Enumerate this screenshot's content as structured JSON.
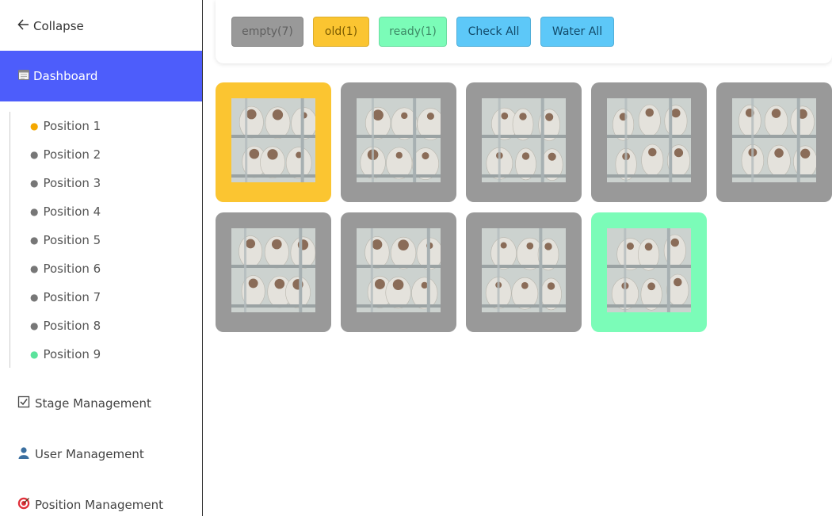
{
  "sidebar": {
    "collapse_label": "Collapse",
    "dashboard_label": "Dashboard",
    "positions": [
      {
        "label": "Position 1",
        "status": "old"
      },
      {
        "label": "Position 2",
        "status": "empty"
      },
      {
        "label": "Position 3",
        "status": "empty"
      },
      {
        "label": "Position 4",
        "status": "empty"
      },
      {
        "label": "Position 5",
        "status": "empty"
      },
      {
        "label": "Position 6",
        "status": "empty"
      },
      {
        "label": "Position 7",
        "status": "empty"
      },
      {
        "label": "Position 8",
        "status": "empty"
      },
      {
        "label": "Position 9",
        "status": "ready"
      }
    ],
    "stage_management_label": "Stage Management",
    "user_management_label": "User Management",
    "position_management_label": "Position Management"
  },
  "toolbar": {
    "empty_label": "empty(7)",
    "old_label": "old(1)",
    "ready_label": "ready(1)",
    "check_all_label": "Check All",
    "water_all_label": "Water All"
  },
  "colors": {
    "empty": "#999999",
    "old": "#fbc531",
    "ready": "#7bfcb8",
    "action": "#5dc8f8",
    "accent": "#4d5dfb"
  },
  "cards": [
    {
      "position": "Position 1",
      "status": "old"
    },
    {
      "position": "Position 2",
      "status": "empty"
    },
    {
      "position": "Position 3",
      "status": "empty"
    },
    {
      "position": "Position 4",
      "status": "empty"
    },
    {
      "position": "Position 5",
      "status": "empty"
    },
    {
      "position": "Position 6",
      "status": "empty"
    },
    {
      "position": "Position 7",
      "status": "empty"
    },
    {
      "position": "Position 8",
      "status": "empty"
    },
    {
      "position": "Position 9",
      "status": "ready"
    }
  ]
}
